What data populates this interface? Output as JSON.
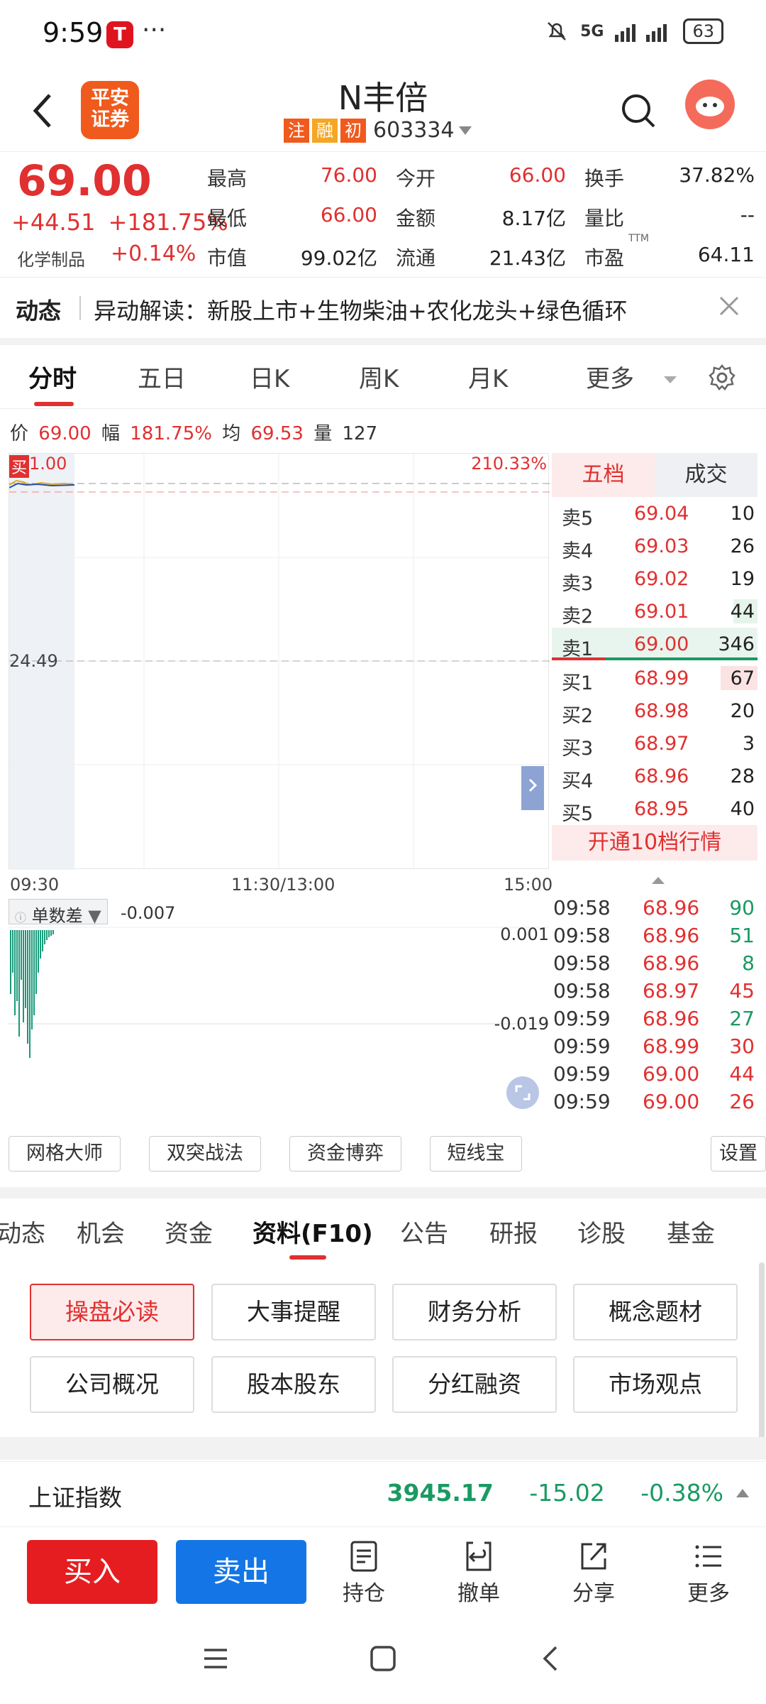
{
  "status_bar": {
    "time": "9:59",
    "app_icon_glyph": "T",
    "dots": "···",
    "signal_label": "5G",
    "battery": "63"
  },
  "header": {
    "logo_line1": "平安",
    "logo_line2": "证券",
    "stock_name": "N丰倍",
    "tags": [
      "注",
      "融",
      "初"
    ],
    "tag_colors": [
      "#f05a1d",
      "#f5a623",
      "#f05a1d"
    ],
    "code": "603334"
  },
  "quote": {
    "price": "69.00",
    "change": "+44.51",
    "change_pct": "+181.75%",
    "industry": "化学制品",
    "industry_change": "+0.14%",
    "fields": [
      {
        "label": "最高",
        "value": "76.00",
        "color": "red"
      },
      {
        "label": "今开",
        "value": "66.00",
        "color": "red"
      },
      {
        "label": "换手",
        "value": "37.82%",
        "color": "dark"
      },
      {
        "label": "最低",
        "value": "66.00",
        "color": "red"
      },
      {
        "label": "金额",
        "value": "8.17亿",
        "color": "dark"
      },
      {
        "label": "量比",
        "value": "--",
        "color": "dark"
      },
      {
        "label": "市值",
        "value": "99.02亿",
        "color": "dark"
      },
      {
        "label": "流通",
        "value": "21.43亿",
        "color": "dark"
      },
      {
        "label": "市盈",
        "value": "64.11",
        "color": "dark"
      }
    ],
    "pe_superscript": "TTM"
  },
  "news": {
    "label": "动态",
    "text": "异动解读：新股上市+生物柴油+农化龙头+绿色循环"
  },
  "chart_tabs": [
    "分时",
    "五日",
    "日K",
    "周K",
    "月K",
    "更多"
  ],
  "info_line": {
    "price_label": "价",
    "price": "69.00",
    "range_label": "幅",
    "range": "181.75%",
    "avg_label": "均",
    "avg": "69.53",
    "vol_label": "量",
    "vol": "127"
  },
  "chart": {
    "top_left_label": "1.00",
    "buy_marker": "买",
    "top_right_label": "210.33%",
    "mid_label": "24.49",
    "time_labels": [
      "09:30",
      "11:30/13:00",
      "15:00"
    ]
  },
  "order_book": {
    "tabs": [
      "五档",
      "成交"
    ],
    "sells": [
      {
        "label": "卖5",
        "price": "69.04",
        "vol": "10"
      },
      {
        "label": "卖4",
        "price": "69.03",
        "vol": "26"
      },
      {
        "label": "卖3",
        "price": "69.02",
        "vol": "19"
      },
      {
        "label": "卖2",
        "price": "69.01",
        "vol": "44"
      },
      {
        "label": "卖1",
        "price": "69.00",
        "vol": "346"
      }
    ],
    "buys": [
      {
        "label": "买1",
        "price": "68.99",
        "vol": "67"
      },
      {
        "label": "买2",
        "price": "68.98",
        "vol": "20"
      },
      {
        "label": "买3",
        "price": "68.97",
        "vol": "3"
      },
      {
        "label": "买4",
        "price": "68.96",
        "vol": "28"
      },
      {
        "label": "买5",
        "price": "68.95",
        "vol": "40"
      }
    ],
    "open10_label": "开通10档行情"
  },
  "indicator": {
    "name": "单数差",
    "value": "-0.007",
    "top_label": "0.001",
    "mid_label": "-0.019"
  },
  "trades": [
    {
      "time": "09:58",
      "price": "68.96",
      "vol": "90",
      "side": "green"
    },
    {
      "time": "09:58",
      "price": "68.96",
      "vol": "51",
      "side": "green"
    },
    {
      "time": "09:58",
      "price": "68.96",
      "vol": "8",
      "side": "green"
    },
    {
      "time": "09:58",
      "price": "68.97",
      "vol": "45",
      "side": "red"
    },
    {
      "time": "09:59",
      "price": "68.96",
      "vol": "27",
      "side": "green"
    },
    {
      "time": "09:59",
      "price": "68.99",
      "vol": "30",
      "side": "red"
    },
    {
      "time": "09:59",
      "price": "69.00",
      "vol": "44",
      "side": "red"
    },
    {
      "time": "09:59",
      "price": "69.00",
      "vol": "26",
      "side": "red"
    }
  ],
  "tools": [
    "网格大师",
    "双突战法",
    "资金博弈",
    "短线宝",
    "设置"
  ],
  "f10_tabs": [
    "动态",
    "机会",
    "资金",
    "资料(F10)",
    "公告",
    "研报",
    "诊股",
    "基金"
  ],
  "f10_grid": [
    "操盘必读",
    "大事提醒",
    "财务分析",
    "概念题材",
    "公司概况",
    "股本股东",
    "分红融资",
    "市场观点"
  ],
  "index_bar": {
    "name": "上证指数",
    "value": "3945.17",
    "change": "-15.02",
    "change_pct": "-0.38%"
  },
  "actions": {
    "buy": "买入",
    "sell": "卖出",
    "items": [
      "持仓",
      "撤单",
      "分享",
      "更多"
    ]
  },
  "colors": {
    "up_red": "#e03030",
    "down_green": "#1a9a63",
    "buy_button": "#e61d20",
    "sell_button": "#1476e6"
  }
}
